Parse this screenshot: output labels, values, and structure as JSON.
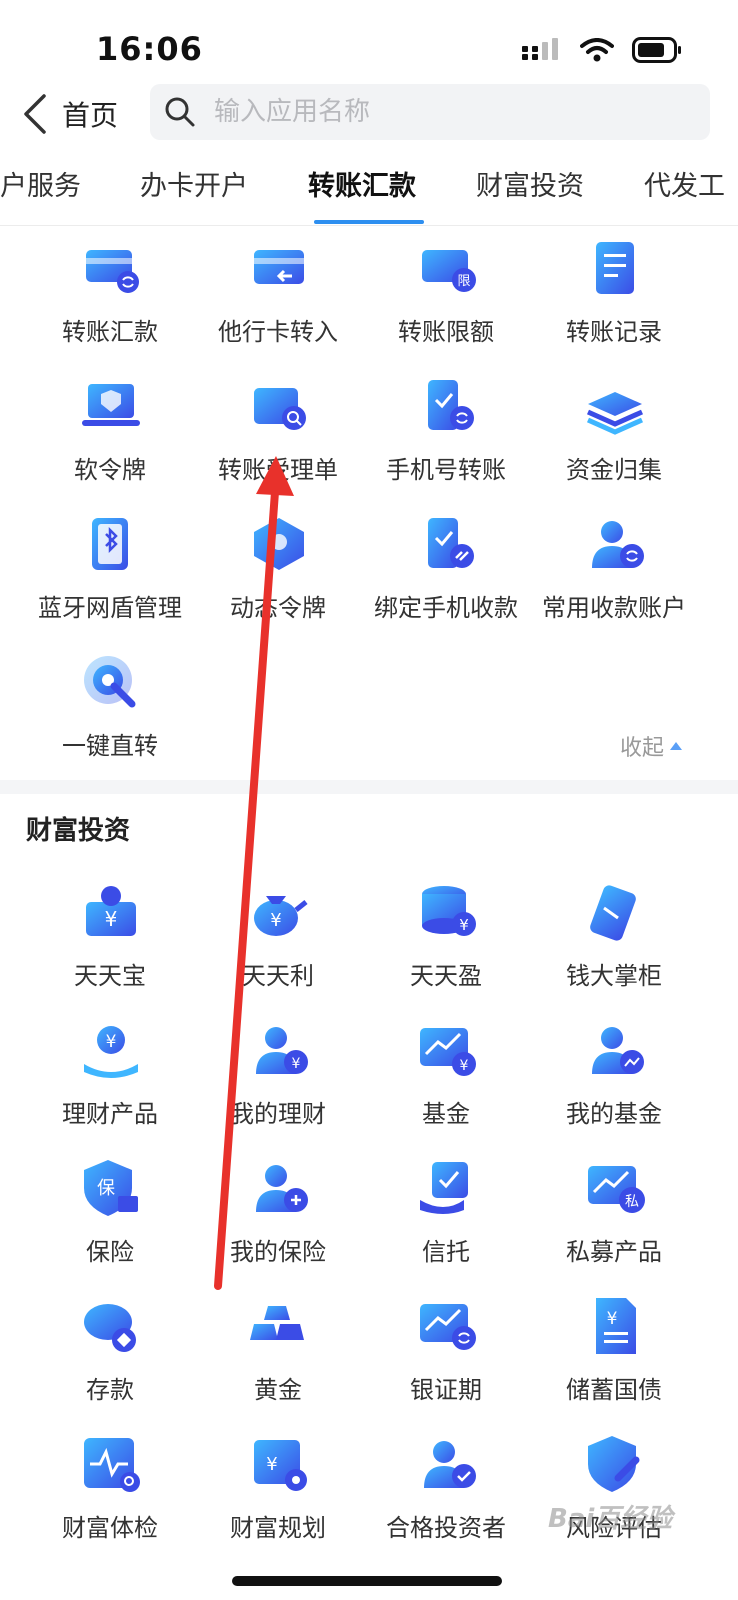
{
  "status": {
    "time": "16:06"
  },
  "header": {
    "back_label": "首页",
    "search_placeholder": "输入应用名称"
  },
  "tabs": [
    {
      "label": "户服务",
      "active": false
    },
    {
      "label": "办卡开户",
      "active": false
    },
    {
      "label": "转账汇款",
      "active": true
    },
    {
      "label": "财富投资",
      "active": false
    },
    {
      "label": "代发工",
      "active": false
    }
  ],
  "transfer_section": {
    "items": [
      {
        "label": "转账汇款",
        "icon": "card-transfer-icon"
      },
      {
        "label": "他行卡转入",
        "icon": "card-inbound-icon"
      },
      {
        "label": "转账限额",
        "icon": "card-limit-icon"
      },
      {
        "label": "转账记录",
        "icon": "record-list-icon"
      },
      {
        "label": "软令牌",
        "icon": "shield-laptop-icon"
      },
      {
        "label": "转账受理单",
        "icon": "search-card-icon"
      },
      {
        "label": "手机号转账",
        "icon": "phone-transfer-icon"
      },
      {
        "label": "资金归集",
        "icon": "money-stack-icon"
      },
      {
        "label": "蓝牙网盾管理",
        "icon": "bluetooth-key-icon"
      },
      {
        "label": "动态令牌",
        "icon": "dynamic-token-icon"
      },
      {
        "label": "绑定手机收款",
        "icon": "phone-link-icon"
      },
      {
        "label": "常用收款账户",
        "icon": "user-sync-icon"
      },
      {
        "label": "一键直转",
        "icon": "tap-target-icon"
      }
    ],
    "collapse_label": "收起"
  },
  "wealth_section": {
    "title": "财富投资",
    "items": [
      {
        "label": "天天宝",
        "icon": "yuan-box-icon"
      },
      {
        "label": "天天利",
        "icon": "money-bag-icon"
      },
      {
        "label": "天天盈",
        "icon": "coin-stack-icon"
      },
      {
        "label": "钱大掌柜",
        "icon": "wallet-card-icon"
      },
      {
        "label": "理财产品",
        "icon": "hand-coin-icon"
      },
      {
        "label": "我的理财",
        "icon": "user-coin-icon"
      },
      {
        "label": "基金",
        "icon": "trend-coin-icon"
      },
      {
        "label": "我的基金",
        "icon": "user-trend-icon"
      },
      {
        "label": "保险",
        "icon": "insurance-shield-icon"
      },
      {
        "label": "我的保险",
        "icon": "user-shield-icon"
      },
      {
        "label": "信托",
        "icon": "trust-check-icon"
      },
      {
        "label": "私募产品",
        "icon": "private-fund-icon"
      },
      {
        "label": "存款",
        "icon": "piggy-bank-icon"
      },
      {
        "label": "黄金",
        "icon": "gold-bar-icon"
      },
      {
        "label": "银证期",
        "icon": "chart-sync-icon"
      },
      {
        "label": "储蓄国债",
        "icon": "bond-document-icon"
      },
      {
        "label": "财富体检",
        "icon": "health-scan-icon"
      },
      {
        "label": "财富规划",
        "icon": "planning-gear-icon"
      },
      {
        "label": "合格投资者",
        "icon": "user-check-icon"
      },
      {
        "label": "风险评估",
        "icon": "shield-pen-icon"
      }
    ]
  },
  "watermark": "Bai百经验",
  "colors": {
    "accent": "#2d8ff0",
    "icon_light": "#3fb6ff",
    "icon_dark": "#3b4ce6",
    "arrow": "#e8312b"
  }
}
